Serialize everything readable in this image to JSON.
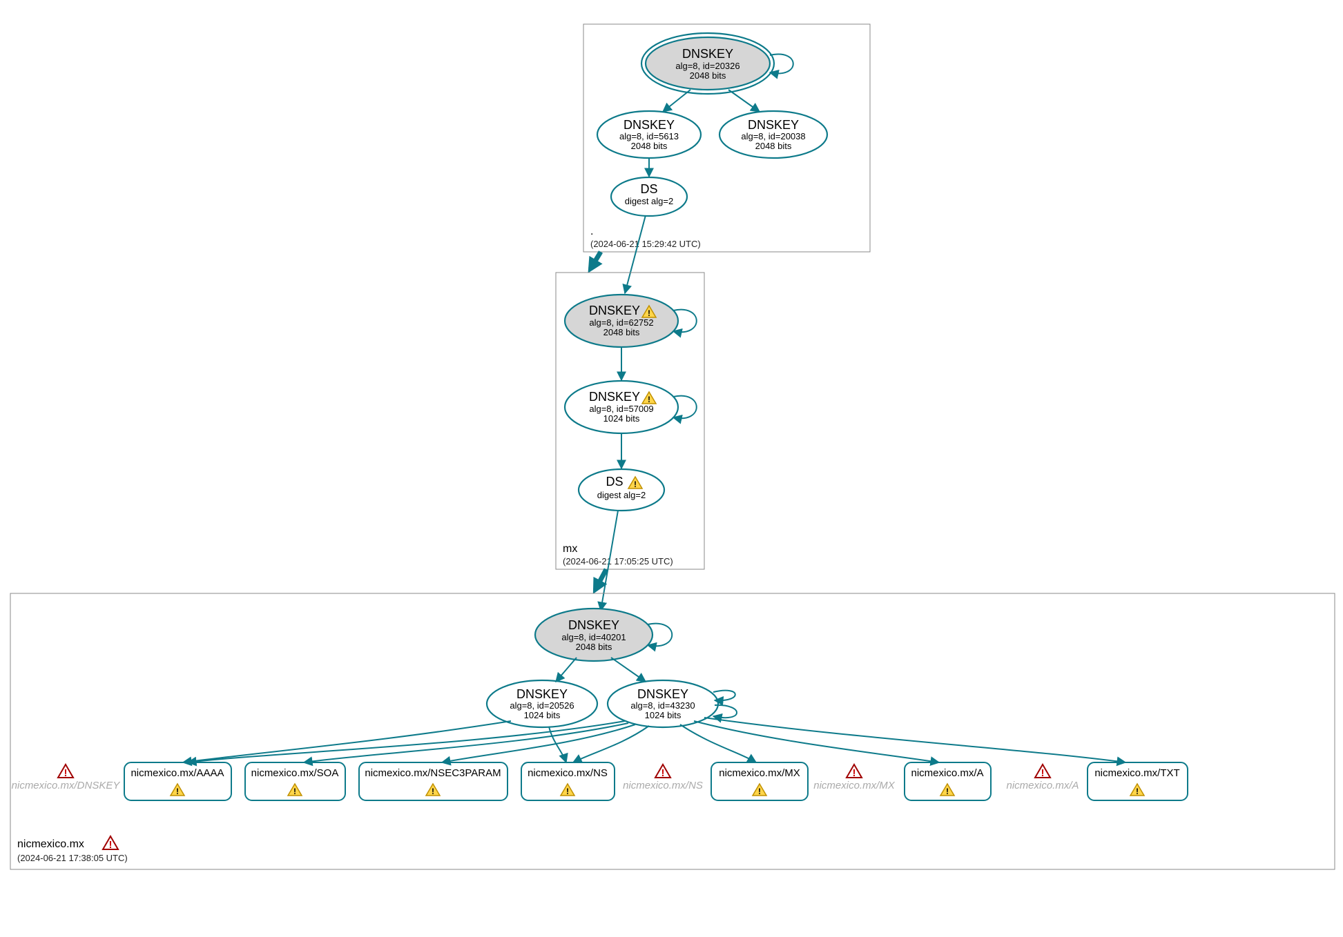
{
  "zones": {
    "root": {
      "label": ".",
      "timestamp": "(2024-06-21 15:29:42 UTC)",
      "nodes": {
        "ksk": {
          "title": "DNSKEY",
          "sub1": "alg=8, id=20326",
          "sub2": "2048 bits"
        },
        "zsk1": {
          "title": "DNSKEY",
          "sub1": "alg=8, id=5613",
          "sub2": "2048 bits"
        },
        "zsk2": {
          "title": "DNSKEY",
          "sub1": "alg=8, id=20038",
          "sub2": "2048 bits"
        },
        "ds": {
          "title": "DS",
          "sub1": "digest alg=2"
        }
      }
    },
    "mx": {
      "label": "mx",
      "timestamp": "(2024-06-21 17:05:25 UTC)",
      "nodes": {
        "ksk": {
          "title": "DNSKEY",
          "sub1": "alg=8, id=62752",
          "sub2": "2048 bits",
          "warn": true
        },
        "zsk": {
          "title": "DNSKEY",
          "sub1": "alg=8, id=57009",
          "sub2": "1024 bits",
          "warn": true
        },
        "ds": {
          "title": "DS",
          "sub1": "digest alg=2",
          "warn": true
        }
      }
    },
    "nicmexico": {
      "label": "nicmexico.mx",
      "timestamp": "(2024-06-21 17:38:05 UTC)",
      "nodes": {
        "ksk": {
          "title": "DNSKEY",
          "sub1": "alg=8, id=40201",
          "sub2": "2048 bits"
        },
        "zsk1": {
          "title": "DNSKEY",
          "sub1": "alg=8, id=20526",
          "sub2": "1024 bits"
        },
        "zsk2": {
          "title": "DNSKEY",
          "sub1": "alg=8, id=43230",
          "sub2": "1024 bits"
        }
      },
      "rrsets": {
        "aaaa": "nicmexico.mx/AAAA",
        "soa": "nicmexico.mx/SOA",
        "nsec3": "nicmexico.mx/NSEC3PARAM",
        "ns": "nicmexico.mx/NS",
        "mxr": "nicmexico.mx/MX",
        "a": "nicmexico.mx/A",
        "txt": "nicmexico.mx/TXT"
      },
      "ghosts": {
        "dnskey": "nicmexico.mx/DNSKEY",
        "ns": "nicmexico.mx/NS",
        "mx": "nicmexico.mx/MX",
        "a": "nicmexico.mx/A"
      }
    }
  }
}
